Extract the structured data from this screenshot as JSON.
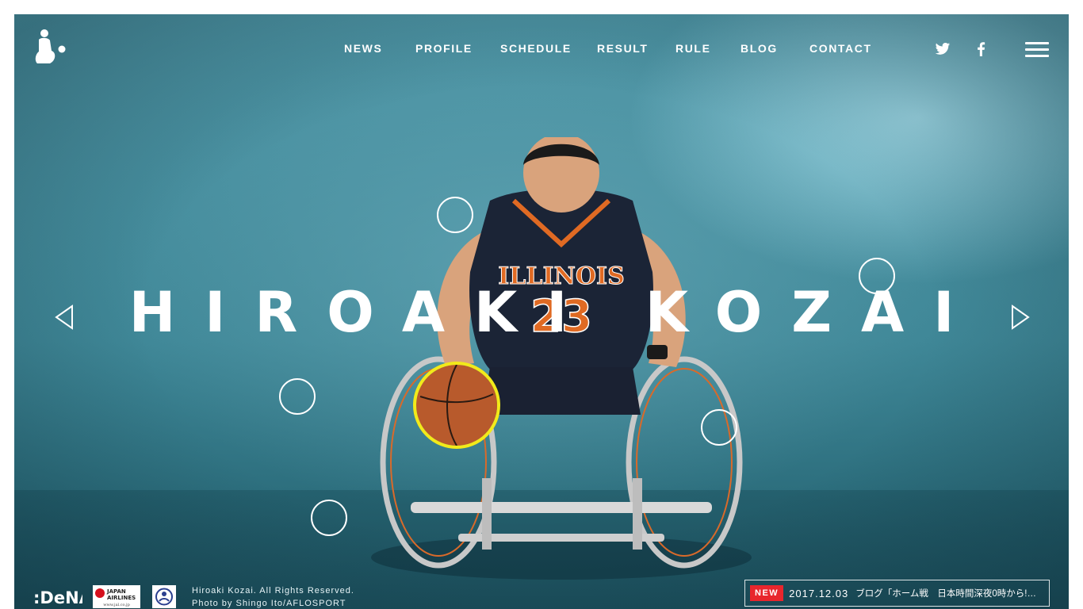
{
  "nav": {
    "items": [
      {
        "label": "NEWS"
      },
      {
        "label": "PROFILE"
      },
      {
        "label": "SCHEDULE"
      },
      {
        "label": "RESULT"
      },
      {
        "label": "RULE"
      },
      {
        "label": "BLOG"
      },
      {
        "label": "CONTACT"
      }
    ]
  },
  "social": {
    "twitter_icon": "twitter-icon",
    "facebook_icon": "facebook-icon"
  },
  "menu_icon": "hamburger-menu-icon",
  "hero": {
    "title": "HIROAKI KOZAI",
    "jersey_text": "ILLINOIS",
    "jersey_number": "23"
  },
  "arrows": {
    "prev_icon": "triangle-left-icon",
    "next_icon": "triangle-right-icon"
  },
  "footer": {
    "sponsors": [
      {
        "name": "DeNA",
        "text": ":DeNA"
      },
      {
        "name": "Japan Airlines",
        "text_line1": "JAPAN",
        "text_line2": "AIRLINES",
        "text_line3": "www.jal.co.jp"
      },
      {
        "name": "emblem"
      }
    ],
    "copyright": "Hiroaki Kozai. All Rights Reserved.",
    "photo_credit": "Photo by Shingo Ito/AFLOSPORT"
  },
  "news": {
    "badge": "NEW",
    "date": "2017.12.03",
    "text": "ブログ「ホーム戦　日本時間深夜0時から!」…"
  },
  "colors": {
    "accent_red": "#e8262d",
    "ball_ring": "#f2ea1a",
    "background_teal": "#3f8797"
  }
}
